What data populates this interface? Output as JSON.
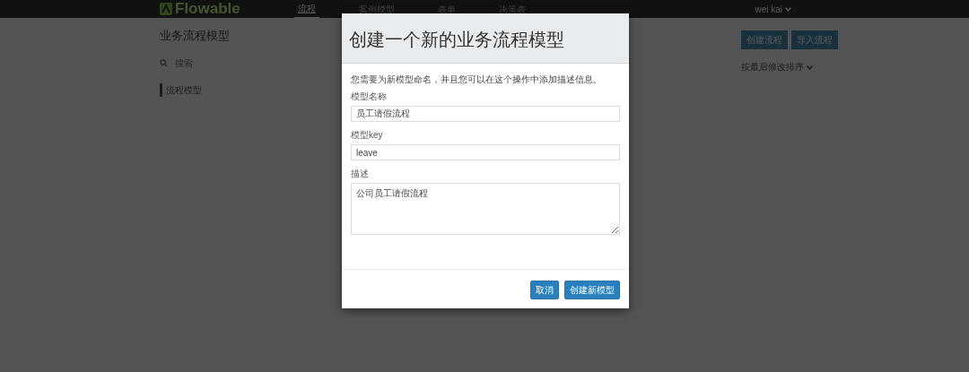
{
  "navbar": {
    "logo": "Flowable",
    "items": [
      {
        "label": "流程",
        "selected": true
      },
      {
        "label": "案例模型",
        "selected": false
      },
      {
        "label": "表单",
        "selected": false
      },
      {
        "label": "决策表",
        "selected": false
      }
    ],
    "user": "wei kai"
  },
  "page": {
    "title": "业务流程模型",
    "search": {
      "placeholder": "搜索"
    },
    "list": [
      {
        "label": "流程模型",
        "selected": true
      }
    ],
    "buttons": [
      "创建流程",
      "导入流程"
    ],
    "sort": "按最后修改排序"
  },
  "dialog": {
    "title": "创建一个新的业务流程模型",
    "intro": "您需要为新模型命名，并且您可以在这个操作中添加描述信息。",
    "fields": [
      {
        "kind": "input",
        "label": "模型名称",
        "value": "员工请假流程"
      },
      {
        "kind": "input",
        "label": "模型key",
        "value": "leave"
      },
      {
        "kind": "textarea",
        "label": "描述",
        "value": "公司员工请假流程"
      }
    ],
    "buttons": [
      "取消",
      "创建新模型"
    ]
  }
}
